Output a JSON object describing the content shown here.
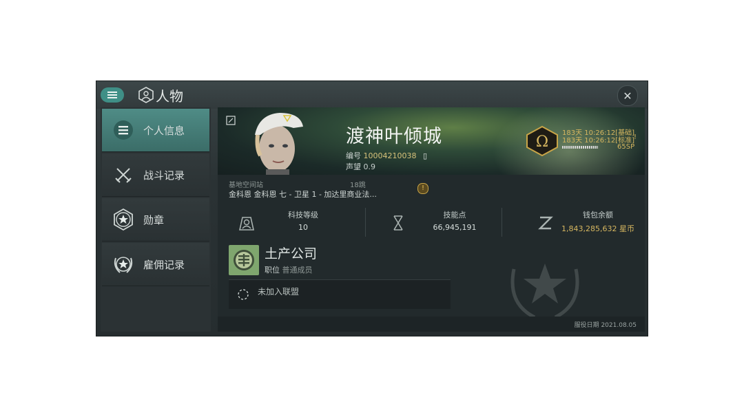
{
  "window": {
    "title": "人物",
    "close_icon": "close-icon"
  },
  "sidebar": {
    "items": [
      {
        "label": "个人信息",
        "icon": "list-icon",
        "active": true
      },
      {
        "label": "战斗记录",
        "icon": "crossed-swords-icon",
        "active": false
      },
      {
        "label": "勋章",
        "icon": "star-badge-icon",
        "active": false
      },
      {
        "label": "雇佣记录",
        "icon": "star-wreath-icon",
        "active": false
      }
    ]
  },
  "profile": {
    "name": "渡神叶倾城",
    "id_label": "编号",
    "id_value": "10004210038",
    "security_label": "声望",
    "security_value": "0.9",
    "omega_line1": "183天 10:26:12[基础]",
    "omega_line2": "183天 10:26:12[标准]",
    "sp_value": "65SP"
  },
  "base": {
    "label": "基地空间站",
    "jumps": "18跳",
    "location": "金科恩 金科恩 七 - 卫星 1 - 加达里商业法..."
  },
  "stats": [
    {
      "label": "科技等级",
      "value": "10",
      "icon": "tech-level-icon"
    },
    {
      "label": "技能点",
      "value": "66,945,191",
      "icon": "skill-points-icon"
    },
    {
      "label": "钱包余额",
      "value": "1,843,285,632 星币",
      "icon": "wallet-icon"
    }
  ],
  "corporation": {
    "name": "土产公司",
    "role_label": "职位",
    "role_value": "普通成员"
  },
  "alliance": {
    "label": "未加入联盟"
  },
  "footer": {
    "date_label": "服役日期 2021.08.05"
  },
  "colors": {
    "accent": "#3f8f86",
    "gold": "#d7b760",
    "background": "#262d2f"
  }
}
